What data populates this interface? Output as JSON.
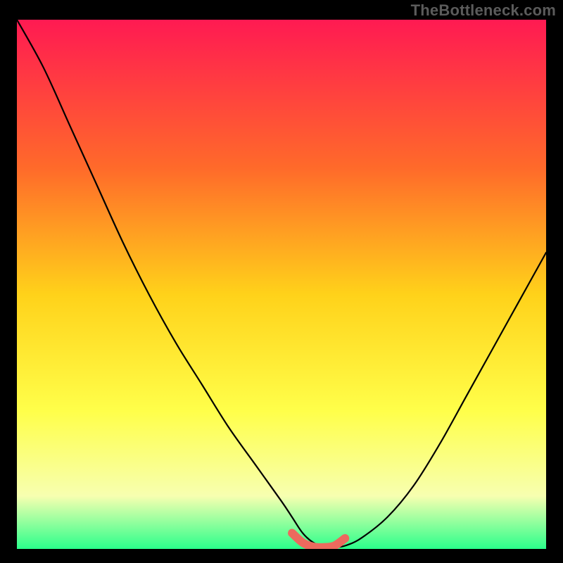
{
  "watermark": "TheBottleneck.com",
  "colors": {
    "background": "#000000",
    "gradient_top": "#ff1a52",
    "gradient_upper_mid": "#ff6a2a",
    "gradient_mid": "#ffd21a",
    "gradient_lower_mid": "#ffff4a",
    "gradient_low": "#f7ffb0",
    "gradient_bottom": "#2bff8b",
    "curve": "#000000",
    "highlight": "#ec6a5e"
  },
  "chart_data": {
    "type": "line",
    "title": "",
    "xlabel": "",
    "ylabel": "",
    "xlim": [
      0,
      100
    ],
    "ylim": [
      0,
      100
    ],
    "series": [
      {
        "name": "bottleneck-curve",
        "x": [
          0,
          5,
          10,
          15,
          20,
          25,
          30,
          35,
          40,
          45,
          50,
          52,
          54,
          56,
          58,
          60,
          62,
          65,
          70,
          75,
          80,
          85,
          90,
          95,
          100
        ],
        "y": [
          100,
          91,
          80,
          69,
          58,
          48,
          39,
          31,
          23,
          16,
          9,
          6,
          3,
          1.2,
          0.4,
          0.3,
          0.6,
          2,
          6,
          12,
          20,
          29,
          38,
          47,
          56
        ]
      },
      {
        "name": "highlight-zone",
        "x": [
          52,
          54,
          56,
          58,
          60,
          62
        ],
        "y": [
          3,
          1.2,
          0.4,
          0.3,
          0.6,
          2
        ]
      }
    ],
    "annotations": []
  }
}
